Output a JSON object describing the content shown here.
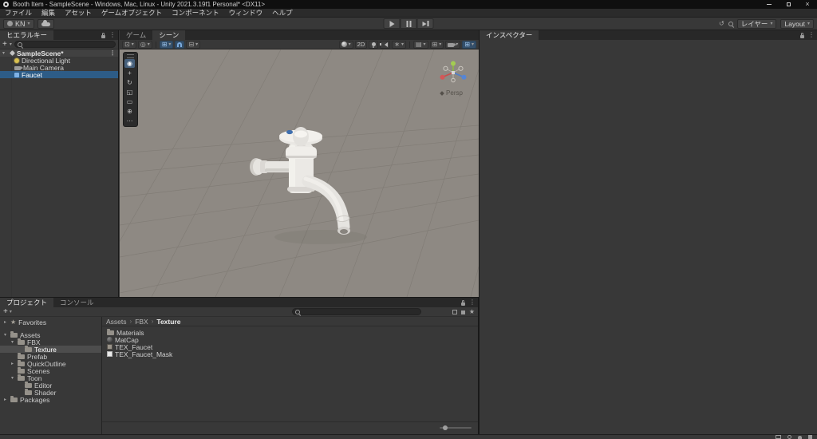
{
  "titlebar": {
    "title": "Booth Item - SampleScene - Windows, Mac, Linux - Unity 2021.3.19f1 Personal* <DX11>"
  },
  "menubar": {
    "items": [
      "ファイル",
      "編集",
      "アセット",
      "ゲームオブジェクト",
      "コンポーネント",
      "ウィンドウ",
      "ヘルプ"
    ]
  },
  "toolbar": {
    "account_label": "KN",
    "layers_label": "レイヤー",
    "layout_label": "Layout"
  },
  "hierarchy": {
    "tab_label": "ヒエラルキー",
    "create_label": "+",
    "scene_label": "SampleScene*",
    "items": [
      {
        "label": "Directional Light",
        "icon": "light"
      },
      {
        "label": "Main Camera",
        "icon": "camera"
      },
      {
        "label": "Faucet",
        "icon": "prefab",
        "selected": true
      }
    ]
  },
  "scene": {
    "tabs": [
      {
        "label": "ゲーム",
        "active": false
      },
      {
        "label": "シーン",
        "active": true
      }
    ],
    "toolbar_left": [
      {
        "name": "tool-handle-position-dropdown",
        "glyph": "pivot",
        "caret": true
      },
      {
        "name": "tool-handle-rotation-dropdown",
        "glyph": "globe",
        "caret": true
      },
      {
        "name": "separator"
      },
      {
        "name": "grid-snapping-dropdown",
        "glyph": "grid",
        "caret": true,
        "active": true
      },
      {
        "name": "snap-magnet-toggle",
        "glyph": "magnet",
        "active": true
      },
      {
        "name": "snap-increment-dropdown",
        "glyph": "grid_alt",
        "caret": true
      }
    ],
    "toolbar_right": [
      {
        "name": "shading-mode-dropdown",
        "glyph": "sphere",
        "caret": true
      },
      {
        "name": "2d-toggle",
        "text": "2D"
      },
      {
        "name": "scene-lighting-toggle",
        "glyph": "bulb"
      },
      {
        "name": "scene-audio-toggle",
        "glyph": "audio"
      },
      {
        "name": "effects-dropdown",
        "glyph": "effects",
        "caret": true
      },
      {
        "name": "separator"
      },
      {
        "name": "hidden-objects-dropdown",
        "glyph": "layers",
        "caret": true
      },
      {
        "name": "grid-visibility-dropdown",
        "glyph": "grid",
        "caret": true
      },
      {
        "name": "camera-view-dropdown",
        "glyph": "camera",
        "caret": true
      },
      {
        "name": "gizmos-dropdown",
        "glyph": "grid",
        "caret": true,
        "active": true
      }
    ],
    "tools": [
      {
        "name": "view-tool",
        "glyph": "view",
        "active": true
      },
      {
        "name": "move-tool",
        "glyph": "move"
      },
      {
        "name": "rotate-tool",
        "glyph": "rotate"
      },
      {
        "name": "scale-tool",
        "glyph": "scale"
      },
      {
        "name": "rect-tool",
        "glyph": "rect"
      },
      {
        "name": "transform-tool",
        "glyph": "transform"
      },
      {
        "name": "more-tools",
        "glyph": "more"
      }
    ],
    "gizmo_persp_label": "Persp"
  },
  "inspector": {
    "tab_label": "インスペクター"
  },
  "project": {
    "tabs": [
      {
        "label": "プロジェクト",
        "active": true
      },
      {
        "label": "コンソール",
        "active": false
      }
    ],
    "create_label": "+",
    "breadcrumb": [
      {
        "label": "Assets"
      },
      {
        "label": "FBX"
      },
      {
        "label": "Texture",
        "current": true
      }
    ],
    "tree": [
      {
        "label": "Favorites",
        "depth": 0,
        "icon": "star",
        "arrow": "collapsed"
      },
      {
        "label": "Assets",
        "depth": 0,
        "icon": "folder",
        "arrow": "expanded",
        "gap_before": true
      },
      {
        "label": "FBX",
        "depth": 1,
        "icon": "folder",
        "arrow": "expanded"
      },
      {
        "label": "Texture",
        "depth": 2,
        "icon": "folder",
        "selected": true
      },
      {
        "label": "Prefab",
        "depth": 1,
        "icon": "folder"
      },
      {
        "label": "QuickOutline",
        "depth": 1,
        "icon": "folder",
        "arrow": "collapsed"
      },
      {
        "label": "Scenes",
        "depth": 1,
        "icon": "folder"
      },
      {
        "label": "Toon",
        "depth": 1,
        "icon": "folder",
        "arrow": "expanded"
      },
      {
        "label": "Editor",
        "depth": 2,
        "icon": "folder"
      },
      {
        "label": "Shader",
        "depth": 2,
        "icon": "folder"
      },
      {
        "label": "Packages",
        "depth": 0,
        "icon": "folder",
        "arrow": "collapsed"
      }
    ],
    "files": [
      {
        "label": "Materials",
        "icon": "folder"
      },
      {
        "label": "MatCap",
        "icon": "material"
      },
      {
        "label": "TEX_Faucet",
        "icon": "texture"
      },
      {
        "label": "TEX_Faucet_Mask",
        "icon": "texture-light"
      }
    ]
  },
  "statusbar": {
    "icons": [
      {
        "name": "console-icon",
        "shape": "console"
      },
      {
        "name": "progress-icon",
        "shape": "activity"
      },
      {
        "name": "notification-icon",
        "shape": "bell"
      },
      {
        "name": "settings-icon",
        "shape": "square"
      }
    ]
  },
  "glyphs": {
    "caret": "▾",
    "dots": "⋮",
    "close": "×",
    "crumb_sep": "›",
    "arrow_open": "▾",
    "arrow_closed": "▸",
    "pivot": "⊡",
    "globe": "◎",
    "grid": "⊞",
    "grid_alt": "⊟",
    "layers": "▤",
    "effects": "∗",
    "view": "◉",
    "move": "+",
    "rotate": "↻",
    "scale": "◱",
    "rect": "▭",
    "transform": "⊕",
    "more": "⋯",
    "history": "↺",
    "star": "★"
  },
  "colors": {
    "selection_blue": "#2d5c87",
    "selection_gray": "#4d4d4d",
    "accent_blue": "#7baadc",
    "viewport_gray": "#8e8983"
  }
}
